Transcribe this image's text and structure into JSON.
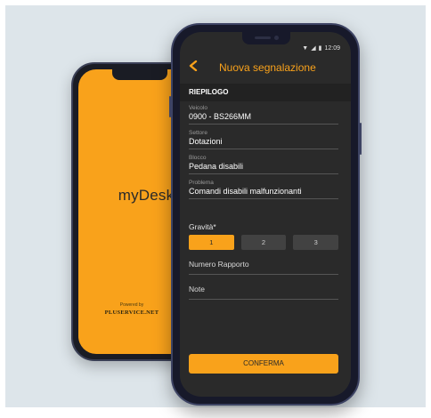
{
  "back_phone": {
    "logo": "myDesk",
    "powered_by": "Powered by",
    "brand": "PLUSERVICE.NET"
  },
  "status_bar": {
    "time": "12:09"
  },
  "header": {
    "back_icon": "chevron-left-icon",
    "title": "Nuova segnalazione"
  },
  "summary": {
    "section_title": "RIEPILOGO",
    "fields": [
      {
        "label": "Veicolo",
        "value": "0900 - BS266MM"
      },
      {
        "label": "Settore",
        "value": "Dotazioni"
      },
      {
        "label": "Blocco",
        "value": "Pedana disabili"
      },
      {
        "label": "Problema",
        "value": "Comandi disabili malfunzionanti"
      }
    ]
  },
  "gravity": {
    "label": "Gravità*",
    "options": [
      "1",
      "2",
      "3"
    ],
    "selected": "1"
  },
  "inputs": {
    "report_number_placeholder": "Numero Rapporto",
    "notes_placeholder": "Note"
  },
  "confirm_label": "CONFERMA",
  "colors": {
    "accent": "#f9a21b",
    "screen_bg": "#2a2a2a",
    "panel_bg": "#dde5ea"
  }
}
